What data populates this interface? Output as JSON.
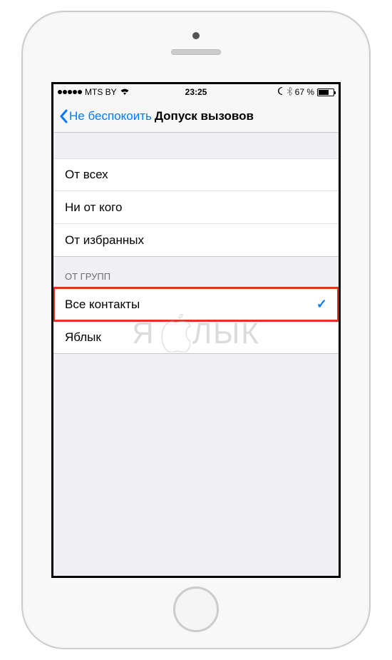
{
  "status_bar": {
    "carrier": "MTS BY",
    "time": "23:25",
    "battery_percent": "67 %"
  },
  "nav": {
    "back_label": "Не беспокоить",
    "title": "Допуск вызовов"
  },
  "section1": {
    "items": [
      {
        "label": "От всех"
      },
      {
        "label": "Ни от кого"
      },
      {
        "label": "От избранных"
      }
    ]
  },
  "section2": {
    "header": "ОТ ГРУПП",
    "items": [
      {
        "label": "Все контакты",
        "checked": true
      },
      {
        "label": "Яблык"
      }
    ]
  },
  "watermark": {
    "left": "Я",
    "right": "ЛЫК"
  }
}
